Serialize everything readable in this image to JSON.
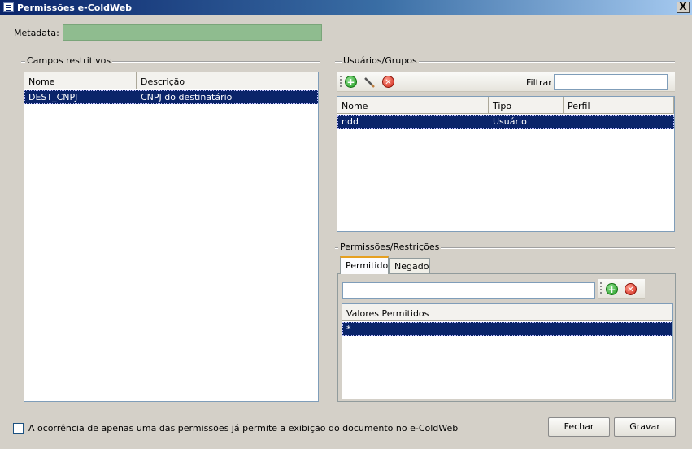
{
  "window": {
    "title": "Permissões e-ColdWeb",
    "close_symbol": "X"
  },
  "metadata": {
    "label": "Metadata:",
    "value": ""
  },
  "campos": {
    "group_label": "Campos restritivos",
    "columns": [
      "Nome",
      "Descrição"
    ],
    "rows": [
      {
        "nome": "DEST_CNPJ",
        "descricao": "CNPJ do destinatário"
      }
    ]
  },
  "usuarios": {
    "group_label": "Usuários/Grupos",
    "filter_label": "Filtrar",
    "filter_value": "",
    "columns": [
      "Nome",
      "Tipo",
      "Perfil"
    ],
    "rows": [
      {
        "nome": "ndd",
        "tipo": "Usuário",
        "perfil": ""
      }
    ]
  },
  "permissoes": {
    "group_label": "Permissões/Restrições",
    "tabs": [
      "Permitido",
      "Negado"
    ],
    "active_tab": "Permitido",
    "input_value": "",
    "column": "Valores Permitidos",
    "rows": [
      "*"
    ]
  },
  "footer": {
    "checkbox_label": "A ocorrência de apenas uma das permissões já permite a exibição do documento no e-ColdWeb",
    "checkbox_checked": false,
    "close_button": "Fechar",
    "save_button": "Gravar"
  },
  "icons": {
    "add": "add-icon",
    "edit": "pencil-icon",
    "delete": "delete-icon",
    "app": "app-icon",
    "accent_green": "#1e9a1e",
    "accent_red": "#d0281a",
    "selection_color": "#0a246a"
  }
}
